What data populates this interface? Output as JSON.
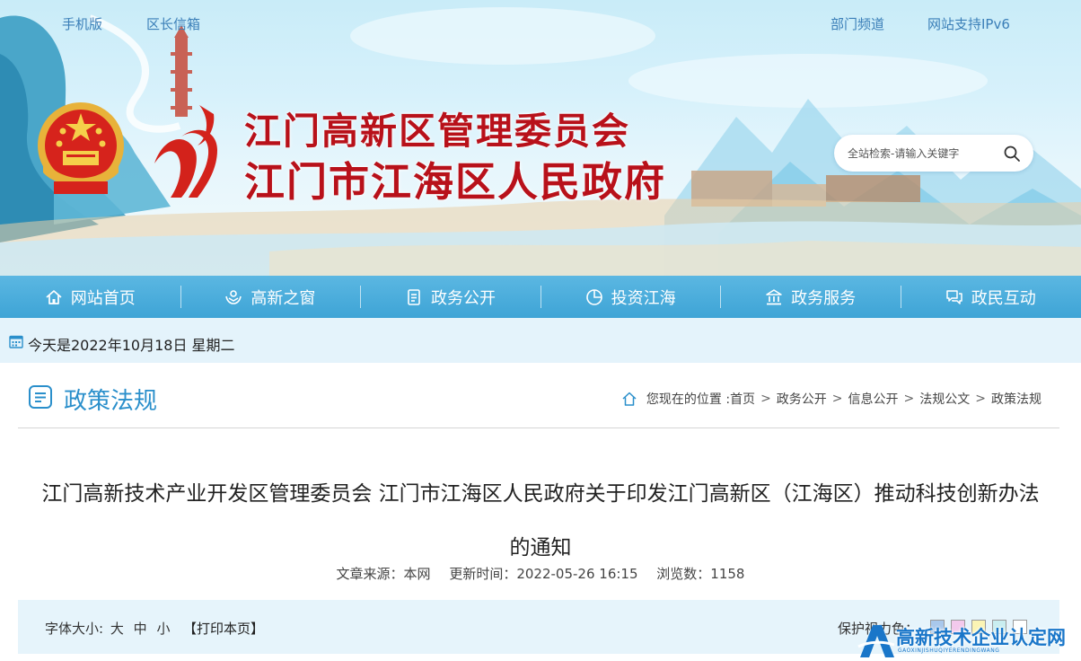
{
  "top_links": {
    "mobile": "手机版",
    "mayor_mailbox": "区长信箱",
    "departments": "部门频道",
    "ipv6": "网站支持IPv6"
  },
  "site_title": {
    "line1": "江门高新区管理委员会",
    "line2": "江门市江海区人民政府"
  },
  "search": {
    "placeholder": "全站检索-请输入关键字",
    "icon": "search-icon"
  },
  "nav": {
    "items": [
      {
        "label": "网站首页",
        "icon": "home-icon"
      },
      {
        "label": "高新之窗",
        "icon": "hands-icon"
      },
      {
        "label": "政务公开",
        "icon": "document-icon"
      },
      {
        "label": "投资江海",
        "icon": "pie-chart-icon"
      },
      {
        "label": "政务服务",
        "icon": "government-building-icon"
      },
      {
        "label": "政民互动",
        "icon": "chat-icon"
      }
    ]
  },
  "date_text": "今天是2022年10月18日 星期二",
  "section": {
    "title": "政策法规",
    "breadcrumb": {
      "prefix": "您现在的位置 :",
      "items": [
        "首页",
        "政务公开",
        "信息公开",
        "法规公文",
        "政策法规"
      ]
    }
  },
  "article": {
    "title_line1": "江门高新技术产业开发区管理委员会 江门市江海区人民政府关于印发江门高新区（江海区）推动科技创新办法",
    "title_line2": "的通知",
    "source_label": "文章来源：",
    "source_value": "本网",
    "updated_label": "更新时间：",
    "updated_value": "2022-05-26 16:15",
    "views_label": "浏览数：",
    "views_value": "1158"
  },
  "toolbar": {
    "font_size_label": "字体大小:",
    "sizes": [
      "大",
      "中",
      "小"
    ],
    "print_label": "【打印本页】",
    "eye_care_label": "保护视力色：",
    "swatches": [
      "#a9c8ec",
      "#f3c9ec",
      "#fbf4b4",
      "#c9eef0",
      "#ffffff"
    ]
  },
  "watermark": {
    "text": "高新技术企业认定网",
    "sub": "GAOXINJISHUQIYERENDINGWANG"
  },
  "colors": {
    "nav_bg": "#48abdb",
    "title_red": "#b8111a",
    "accent_blue": "#2a8fcb"
  }
}
